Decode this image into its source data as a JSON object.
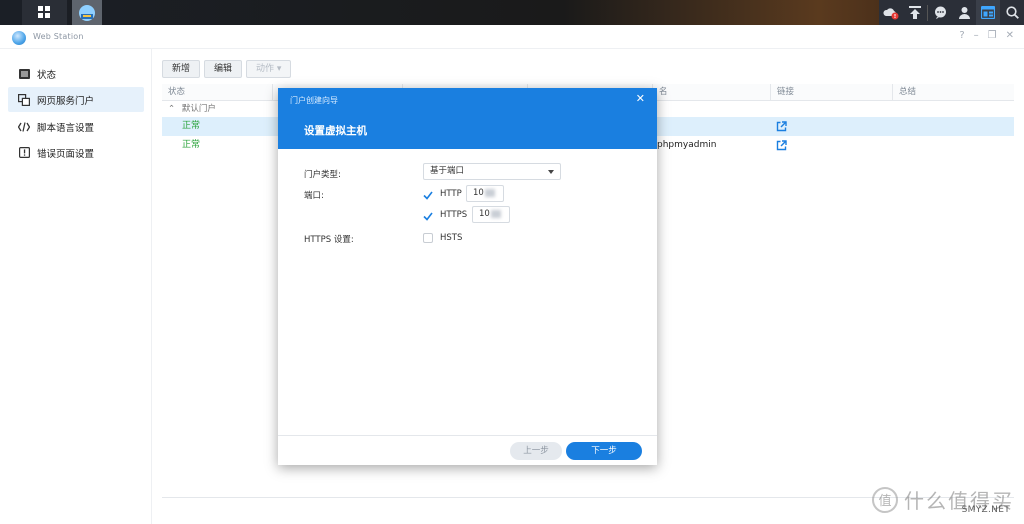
{
  "app": {
    "title": "Web Station"
  },
  "window_controls": {
    "help": "?",
    "minimize": "–",
    "restore": "❐",
    "close": "✕"
  },
  "sidebar": {
    "items": [
      {
        "label": "状态",
        "icon": "list-icon"
      },
      {
        "label": "网页服务门户",
        "icon": "portal-icon",
        "active": true
      },
      {
        "label": "脚本语言设置",
        "icon": "code-icon"
      },
      {
        "label": "错误页面设置",
        "icon": "alert-icon"
      }
    ]
  },
  "toolbar": {
    "add_label": "新增",
    "edit_label": "编辑",
    "action_label": "动作 ▾"
  },
  "grid": {
    "columns": [
      "状态",
      "",
      "",
      "",
      "",
      "名",
      "链接",
      "总结"
    ],
    "group_label": "默认门户",
    "rows": [
      {
        "status": "正常",
        "name": "",
        "selected": true
      },
      {
        "status": "正常",
        "name": "phpmyadmin",
        "selected": false
      }
    ]
  },
  "dialog": {
    "caption": "门户创建向导",
    "title": "设置虚拟主机",
    "close": "✕",
    "portal_type_label": "门户类型:",
    "portal_type_value": "基于端口",
    "port_label": "端口:",
    "http_label": "HTTP",
    "http_checked": true,
    "http_port_visible": "10",
    "https_label": "HTTPS",
    "https_checked": true,
    "https_port_visible": "10",
    "https_settings_label": "HTTPS 设置:",
    "hsts_label": "HSTS",
    "hsts_checked": false,
    "prev_label": "上一步",
    "next_label": "下一步"
  },
  "watermark": {
    "badge": "值",
    "text": "什么值得买",
    "small": "SMYZ.NET"
  },
  "colors": {
    "accent": "#1a7fe0",
    "status_ok": "#29a33a",
    "selected_row": "#ddeffc"
  }
}
